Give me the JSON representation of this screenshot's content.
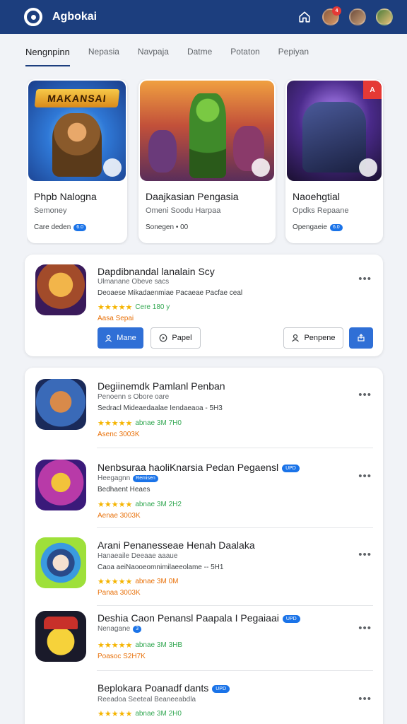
{
  "header": {
    "title": "Agbokai",
    "notification_count": "4"
  },
  "tabs": [
    {
      "label": "Nengnpinn"
    },
    {
      "label": "Nepasia"
    },
    {
      "label": "Navpaja"
    },
    {
      "label": "Datme"
    },
    {
      "label": "Potaton"
    },
    {
      "label": "Pepiyan"
    }
  ],
  "featured": [
    {
      "art_text": "MAKANSAI",
      "title": "Phpb Nalogna",
      "subtitle": "Semoney",
      "meta": "Care deden",
      "meta_pill": "6.0"
    },
    {
      "art_text": "",
      "title": "Daajkasian Pengasia",
      "subtitle": "Omeni Soodu Harpaa",
      "meta": "Sonegen • 00",
      "meta_pill": ""
    },
    {
      "art_text": "",
      "corner": "A",
      "title": "Naoehgtial",
      "subtitle": "Opdks Repaane",
      "meta": "Opengaeie",
      "meta_pill": "6.0"
    }
  ],
  "expanded": {
    "title": "Dapdibnandal lanalain Scy",
    "subtitle": "Ulmanane Obeve sacs",
    "description": "Deoaese Mikadaenmiae Pacaeae Pacfae ceal",
    "rating_text": "Cere 180 y",
    "extra": "Aasa Sepai",
    "buttons": {
      "install": "Mane",
      "play": "Papel",
      "preview": "Penpene"
    }
  },
  "list": [
    {
      "title": "Degiinemdk Pamlanl Penban",
      "subtitle": "Penoenn s  Obore oare",
      "description": "Sedracl Mideaedaalae Iendaeaoa - 5H3",
      "rating_text": "abnae 3M 7H0",
      "rating_color": "green",
      "extra": "Asenc 3003K",
      "badge": ""
    },
    {
      "title": "Nenbsuraa haoliKnarsia Pedan Pegaensl",
      "subtitle": "Heegagnn",
      "subtitle_pill": "Remisen",
      "description": "Bedhaent Heaes",
      "rating_text": "abnae 3M 2H2",
      "rating_color": "green",
      "extra": "Aenae 3003K",
      "badge": "UPD"
    },
    {
      "title": "Arani Penanesseae Henah Daalaka",
      "subtitle": "Hanaeaile Deeaae aaaue",
      "description": "Caoa aeiNaooeomnimilaeeolame -- 5H1",
      "rating_text": "abnae 3M 0M",
      "rating_color": "orange",
      "extra": "Panaa 3003K",
      "badge": ""
    },
    {
      "title": "Deshia Caon Penansl Paapala I Pegaiaai",
      "subtitle": "Nenagane",
      "subtitle_pill": "3",
      "description": "",
      "rating_text": "abnae 3M 3HB",
      "rating_color": "green",
      "extra": "Poasoc S2H7K",
      "badge": "UPD"
    },
    {
      "title": "Beplokara Poanadf dants",
      "subtitle": "Reeadoa Seeteal Beaneeabdla",
      "description": "",
      "rating_text": "abnae 3M 2H0",
      "rating_color": "green",
      "extra": "",
      "badge": "UPD"
    }
  ],
  "colors": {
    "topbar": "#1c3e7e",
    "accent": "#2f6fd6",
    "star": "#f5b400"
  }
}
